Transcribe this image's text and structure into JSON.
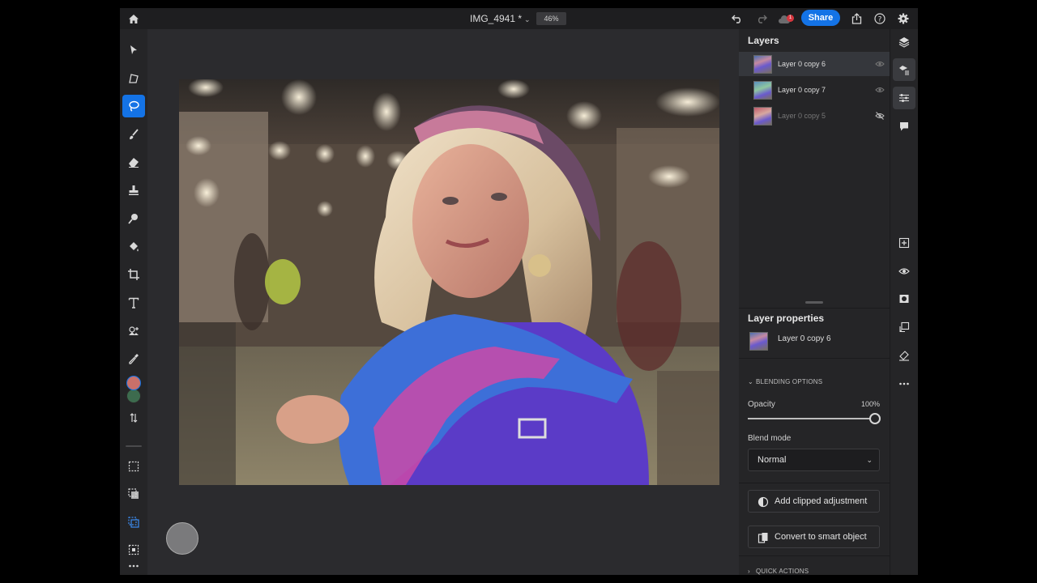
{
  "topbar": {
    "home_icon": "home-icon",
    "document_title": "IMG_4941 *",
    "zoom_level": "46%",
    "share_label": "Share",
    "notification_count": "1"
  },
  "toolbar": {
    "tools": [
      "select-icon",
      "transform-icon",
      "lasso-icon",
      "brush-icon",
      "eraser-icon",
      "clone-stamp-icon",
      "healing-icon",
      "fill-icon",
      "crop-icon",
      "type-icon",
      "place-image-icon",
      "eyedropper-icon"
    ],
    "foreground_color": "#c9706a",
    "background_color": "#3d6b4e"
  },
  "layers_panel": {
    "title": "Layers",
    "layers": [
      {
        "name": "Layer 0 copy 6",
        "visible": true,
        "selected": true
      },
      {
        "name": "Layer 0 copy 7",
        "visible": true,
        "selected": false
      },
      {
        "name": "Layer 0 copy 5",
        "visible": false,
        "selected": false
      }
    ]
  },
  "layer_properties": {
    "title": "Layer properties",
    "layer_name": "Layer 0 copy 6",
    "blending_options_label": "BLENDING OPTIONS",
    "opacity_label": "Opacity",
    "opacity_value": "100%",
    "opacity": 1.0,
    "blend_mode_label": "Blend mode",
    "blend_mode_value": "Normal",
    "add_clipped_adjustment_label": "Add clipped adjustment",
    "convert_smart_object_label": "Convert to smart object",
    "quick_actions_label": "QUICK ACTIONS"
  },
  "colors": {
    "accent": "#1473e6",
    "background": "#1e1e20",
    "panel": "#252527"
  }
}
